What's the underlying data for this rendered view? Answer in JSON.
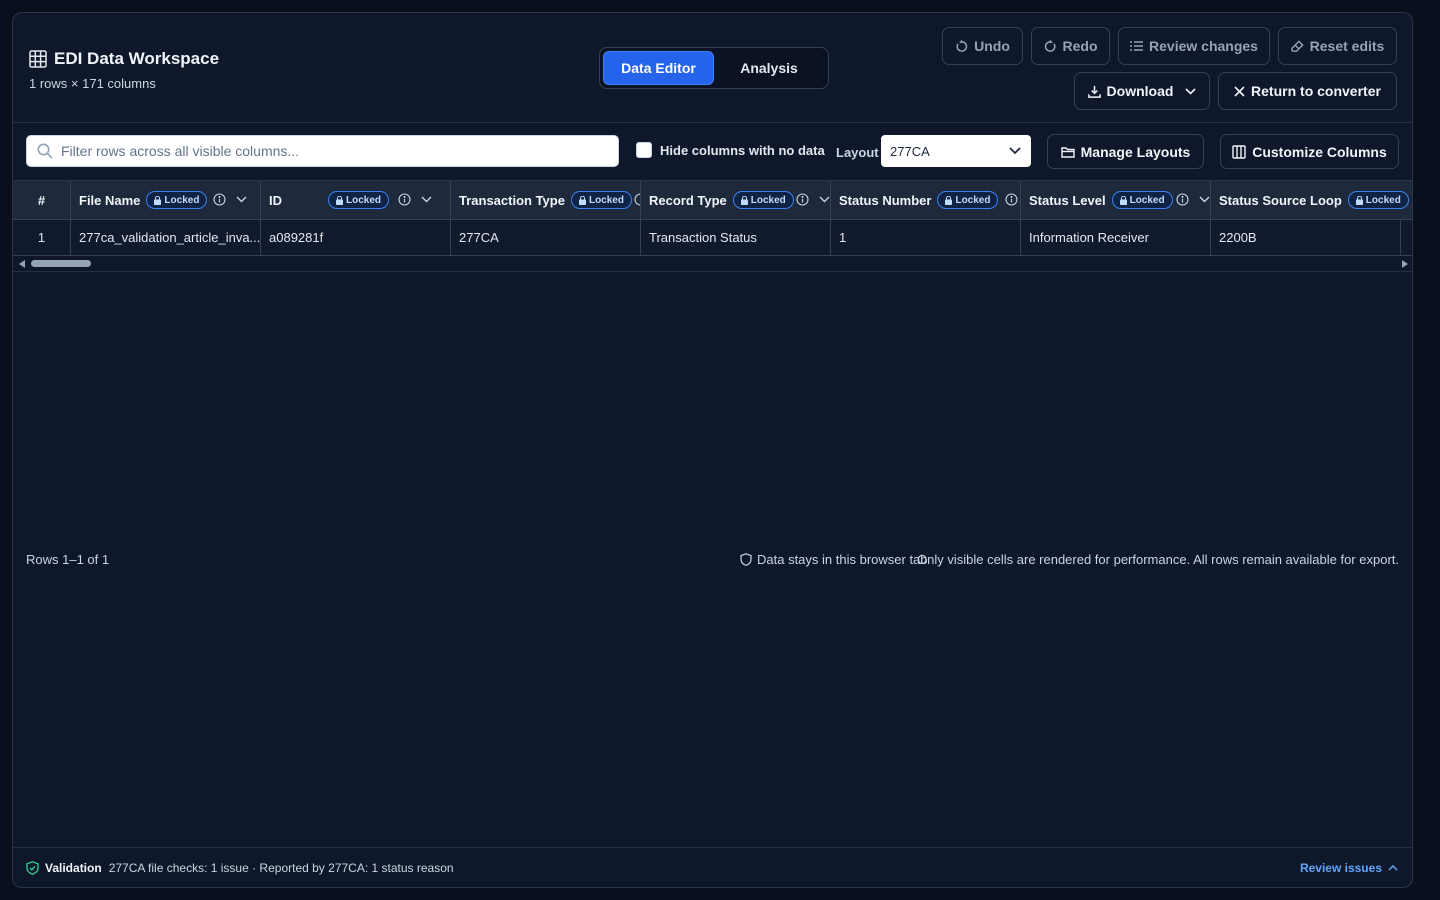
{
  "header": {
    "title": "EDI Data Workspace",
    "subtitle": "1 rows × 171 columns",
    "grid_icon": "table-grid-icon"
  },
  "modes": {
    "active": "Data Editor",
    "inactive": "Analysis"
  },
  "toolbar": {
    "undo": "Undo",
    "redo": "Redo",
    "review_changes": "Review changes",
    "reset_edits": "Reset edits",
    "download": "Download",
    "return": "Return to converter"
  },
  "filter": {
    "placeholder": "Filter rows across all visible columns...",
    "hide_empty_label": "Hide columns with no data",
    "layout_label": "Layout",
    "layout_value": "277CA",
    "manage_layouts": "Manage Layouts",
    "customize_columns": "Customize Columns"
  },
  "grid": {
    "badge": "Locked",
    "columns": [
      "#",
      "File Name",
      "ID",
      "Transaction Type",
      "Record Type",
      "Status Number",
      "Status Level",
      "Status Source Loop"
    ],
    "row": [
      "1",
      "277ca_validation_article_inva...",
      "a089281f",
      "277CA",
      "Transaction Status",
      "1",
      "Information Receiver",
      "2200B"
    ]
  },
  "footer": {
    "rows": "Rows 1–1 of 1",
    "privacy": "Data stays in this browser tab",
    "perf": "Only visible cells are rendered for performance. All rows remain available for export."
  },
  "validation": {
    "label": "Validation",
    "text": "277CA file checks: 1 issue · Reported by 277CA: 1 status reason",
    "review": "Review issues"
  },
  "colors": {
    "accent": "#2563eb",
    "link": "#60a5fa",
    "background": "#0f172a"
  }
}
